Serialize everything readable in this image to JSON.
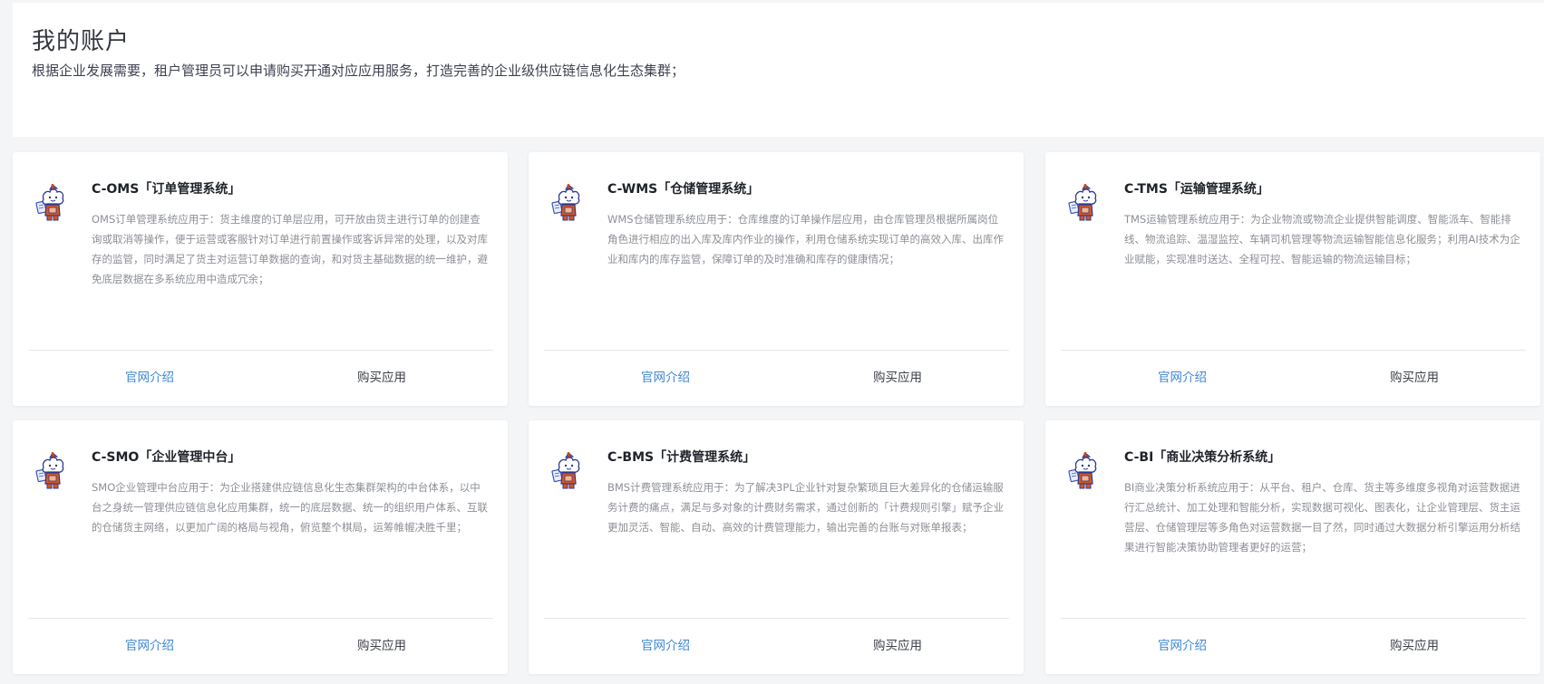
{
  "header": {
    "title": "我的账户",
    "subtitle": "根据企业发展需要，租户管理员可以申请购买开通对应应用服务，打造完善的企业级供应链信息化生态集群；"
  },
  "cards": [
    {
      "title": "C-OMS「订单管理系统」",
      "description": "OMS订单管理系统应用于：货主维度的订单层应用，可开放由货主进行订单的创建查询或取消等操作，便于运营或客服针对订单进行前置操作或客诉异常的处理，以及对库存的监管，同时满足了货主对运营订单数据的查询，和对货主基础数据的统一维护，避免底层数据在多系统应用中造成冗余；",
      "intro_label": "官网介绍",
      "buy_label": "购买应用"
    },
    {
      "title": "C-WMS「仓储管理系统」",
      "description": "WMS仓储管理系统应用于：仓库维度的订单操作层应用，由仓库管理员根据所属岗位角色进行相应的出入库及库内作业的操作，利用仓储系统实现订单的高效入库、出库作业和库内的库存监管，保障订单的及时准确和库存的健康情况；",
      "intro_label": "官网介绍",
      "buy_label": "购买应用"
    },
    {
      "title": "C-TMS「运输管理系统」",
      "description": "TMS运输管理系统应用于：为企业物流或物流企业提供智能调度、智能派车、智能排线、物流追踪、温湿监控、车辆司机管理等物流运输智能信息化服务；利用AI技术为企业赋能，实现准时送达、全程可控、智能运输的物流运输目标；",
      "intro_label": "官网介绍",
      "buy_label": "购买应用"
    },
    {
      "title": "C-SMO「企业管理中台」",
      "description": "SMO企业管理中台应用于：为企业搭建供应链信息化生态集群架构的中台体系，以中台之身统一管理供应链信息化应用集群，统一的底层数据、统一的组织用户体系、互联的仓储货主网络，以更加广阔的格局与视角，俯览整个棋局，运筹帷幄决胜千里；",
      "intro_label": "官网介绍",
      "buy_label": "购买应用"
    },
    {
      "title": "C-BMS「计费管理系统」",
      "description": "BMS计费管理系统应用于：为了解决3PL企业针对复杂繁琐且巨大差异化的仓储运输服务计费的痛点，满足与多对象的计费财务需求，通过创新的「计费规则引擎」赋予企业更加灵活、智能、自动、高效的计费管理能力，输出完善的台账与对账单报表；",
      "intro_label": "官网介绍",
      "buy_label": "购买应用"
    },
    {
      "title": "C-BI「商业决策分析系统」",
      "description": "BI商业决策分析系统应用于：从平台、租户、仓库、货主等多维度多视角对运营数据进行汇总统计、加工处理和智能分析，实现数据可视化、图表化，让企业管理层、货主运营层、仓储管理层等多角色对运营数据一目了然，同时通过大数据分析引擎运用分析结果进行智能决策协助管理者更好的运营；",
      "intro_label": "官网介绍",
      "buy_label": "购买应用"
    }
  ]
}
